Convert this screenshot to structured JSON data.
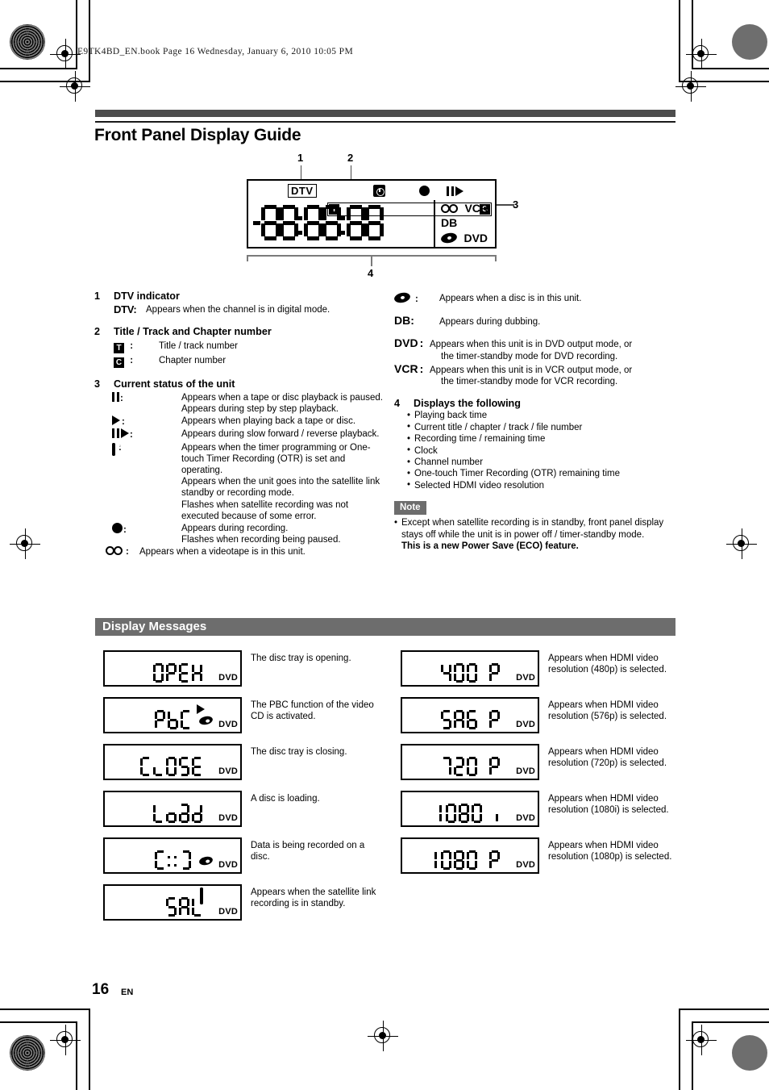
{
  "header": {
    "book_line": "E9TK4BD_EN.book   Page 16   Wednesday, January 6, 2010   10:05 PM"
  },
  "page": {
    "title": "Front Panel Display Guide",
    "number": "16",
    "language": "EN"
  },
  "diagram": {
    "callouts": [
      "1",
      "2",
      "3",
      "4"
    ],
    "dtv_label": "DTV",
    "title_glyph": "T",
    "chapter_glyph": "C",
    "vcr_label": "VCR",
    "db_label": "DB",
    "dvd_label": "DVD",
    "segment_text": "-88:88:88"
  },
  "sections": [
    {
      "num": "1",
      "heading": "DTV indicator",
      "rows": [
        {
          "key": "DTV:",
          "value": "Appears when the channel is in digital mode."
        }
      ]
    },
    {
      "num": "2",
      "heading": "Title / Track and Chapter number",
      "rows": [
        {
          "key": "T",
          "sep": ":",
          "value": "Title / track number"
        },
        {
          "key": "C",
          "sep": ":",
          "value": "Chapter number"
        }
      ]
    },
    {
      "num": "3",
      "heading": "Current status of the unit",
      "rows": [
        {
          "key": "pause-icon",
          "sep": ":",
          "value": "Appears when a tape or disc playback is paused.\nAppears during step by step playback."
        },
        {
          "key": "play-icon",
          "sep": ":",
          "value": "Appears when playing back a tape or disc."
        },
        {
          "key": "slow-icon",
          "sep": ":",
          "value": "Appears during slow forward / reverse playback."
        },
        {
          "key": "timer-icon",
          "sep": ":",
          "value": "Appears when the timer programming or One-touch Timer Recording (OTR) is set and operating.\nAppears when the unit goes into the satellite link standby or recording mode.\nFlashes when satellite recording was not executed because of some error."
        },
        {
          "key": "record-icon",
          "sep": ":",
          "value": "Appears during recording.\nFlashes when recording being paused."
        },
        {
          "key": "videotape-icon",
          "sep": ":",
          "value": "Appears when a videotape is in this unit."
        },
        {
          "key": "disc-icon",
          "sep": ":",
          "value": "Appears when a disc is in this unit."
        },
        {
          "key": "DB",
          "sep": ":",
          "value": "Appears during dubbing."
        },
        {
          "key": "DVD",
          "sep": ":",
          "value": "Appears when this unit is in DVD output mode, or the timer-standby mode for DVD recording."
        },
        {
          "key": "VCR",
          "sep": ":",
          "value": "Appears when this unit is in VCR output mode, or the timer-standby mode for VCR recording."
        }
      ]
    },
    {
      "num": "4",
      "heading": "Displays the following",
      "bullets": [
        "Playing back time",
        "Current title / chapter / track / file number",
        "Recording time / remaining time",
        "Clock",
        "Channel number",
        "One-touch Timer Recording (OTR) remaining time",
        "Selected HDMI video resolution"
      ]
    }
  ],
  "note": {
    "tag": "Note",
    "body": "Except when satellite recording is in standby, front panel display stays off while the unit is in power off / timer-standby mode.",
    "bold_line": "This is a new Power Save (ECO) feature."
  },
  "display_messages": {
    "section_title": "Display Messages",
    "dvd_tag": "DVD",
    "left": [
      {
        "segments": "OPEN",
        "desc": "The disc tray is opening.",
        "disc": false,
        "play": false,
        "clock": false
      },
      {
        "segments": "PbC",
        "desc": "The PBC function of the video CD is activated.",
        "disc": true,
        "play": true,
        "clock": false
      },
      {
        "segments": "CLOSE",
        "desc": "The disc tray is closing.",
        "disc": false,
        "play": false,
        "clock": false
      },
      {
        "segments": "Load",
        "desc": "A disc is loading.",
        "disc": false,
        "play": false,
        "clock": false
      },
      {
        "segments": "[::]",
        "desc": "Data is being recorded on a disc.",
        "disc": true,
        "play": false,
        "clock": false
      },
      {
        "segments": "SAT",
        "desc": "Appears when the satellite link recording is in standby.",
        "disc": false,
        "play": false,
        "clock": true
      }
    ],
    "right": [
      {
        "segments": "480 P",
        "desc": "Appears when HDMI video resolution (480p) is selected."
      },
      {
        "segments": "576 P",
        "desc": "Appears when HDMI video resolution (576p) is selected."
      },
      {
        "segments": "720 P",
        "desc": "Appears when HDMI video resolution (720p) is selected."
      },
      {
        "segments": "1080 i",
        "desc": "Appears when HDMI video resolution (1080i) is selected."
      },
      {
        "segments": "1080 P",
        "desc": "Appears when HDMI video resolution (1080p) is selected."
      }
    ]
  }
}
